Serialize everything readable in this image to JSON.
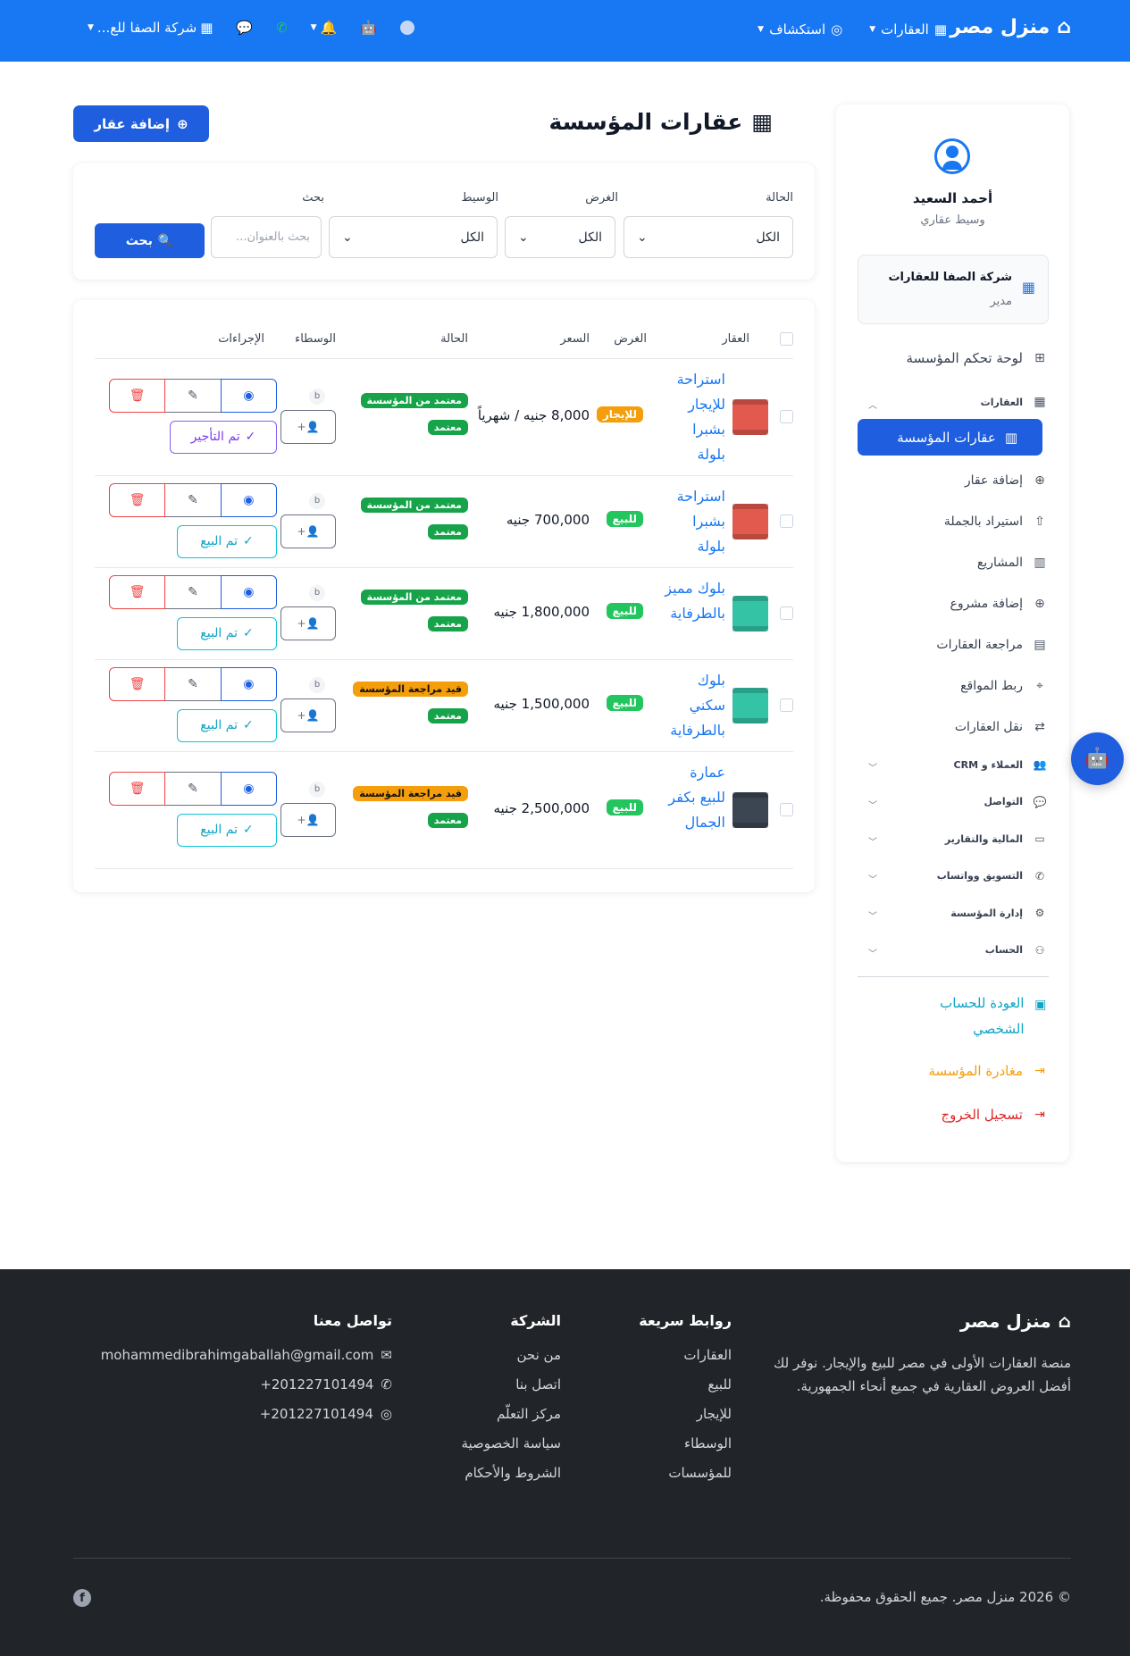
{
  "navbar": {
    "brand": "منزل مصر",
    "menu": [
      {
        "label": "العقارات",
        "icon": "building-icon"
      },
      {
        "label": "استكشاف",
        "icon": "compass-icon"
      }
    ],
    "org_switcher": "شركة الصفا للع..."
  },
  "page": {
    "title": "عقارات المؤسسة",
    "add_button": "إضافة عقار"
  },
  "filters": {
    "status_label": "الحالة",
    "status_value": "الكل",
    "purpose_label": "الغرض",
    "purpose_value": "الكل",
    "broker_label": "الوسيط",
    "broker_value": "الكل",
    "search_label": "بحث",
    "search_placeholder": "بحث بالعنوان...",
    "search_button": "بحث"
  },
  "table": {
    "headers": {
      "property": "العقار",
      "purpose": "الغرض",
      "price": "السعر",
      "status": "الحالة",
      "brokers": "الوسطاء",
      "actions": "الإجراءات"
    },
    "rows": [
      {
        "name": "استراحة للإيجار بشبرا بلولة",
        "purpose": "للإيجار",
        "purpose_color": "#f59e0b",
        "price": "8,000 جنيه / شهرياً",
        "status1": "معتمد من المؤسسة",
        "status2": "معتمد",
        "broker_initial": "b",
        "done_label": "تم التأجير",
        "thumb_color": "#e25a4d"
      },
      {
        "name": "استراحة بشبرا بلولة",
        "purpose": "للبيع",
        "purpose_color": "#22c55e",
        "price": "700,000 جنيه",
        "status1": "معتمد من المؤسسة",
        "status2": "معتمد",
        "broker_initial": "b",
        "done_label": "تم البيع",
        "thumb_color": "#e25a4d"
      },
      {
        "name": "بلوك مميز بالطرفاية",
        "purpose": "للبيع",
        "purpose_color": "#22c55e",
        "price": "1,800,000 جنيه",
        "status1": "معتمد من المؤسسة",
        "status2": "معتمد",
        "broker_initial": "b",
        "done_label": "تم البيع",
        "thumb_color": "#34c3a5"
      },
      {
        "name": "بلوك سكني بالطرفاية",
        "purpose": "للبيع",
        "purpose_color": "#22c55e",
        "price": "1,500,000 جنيه",
        "status1": "قيد مراجعة المؤسسة",
        "status2": "معتمد",
        "broker_initial": "b",
        "done_label": "تم البيع",
        "thumb_color": "#34c3a5"
      },
      {
        "name": "عمارة للبيع بكفر الجمال",
        "purpose": "للبيع",
        "purpose_color": "#22c55e",
        "price": "2,500,000 جنيه",
        "status1": "قيد مراجعة المؤسسة",
        "status2": "معتمد",
        "broker_initial": "b",
        "done_label": "تم البيع",
        "thumb_color": "#3b4652"
      }
    ]
  },
  "sidebar": {
    "user_name": "أحمد السعيد",
    "user_role": "وسيط عقاري",
    "org_name": "شركة الصفا للعقارات",
    "org_role": "مدير",
    "dashboard": "لوحة تحكم المؤسسة",
    "properties_group": "العقارات",
    "active_item": "عقارات المؤسسة",
    "items": [
      {
        "label": "إضافة عقار",
        "icon": "plus-circle-icon"
      },
      {
        "label": "استيراد بالجملة",
        "icon": "upload-icon"
      },
      {
        "label": "المشاريع",
        "icon": "chart-icon"
      },
      {
        "label": "إضافة مشروع",
        "icon": "plus-circle-icon"
      },
      {
        "label": "مراجعة العقارات",
        "icon": "clipboard-icon"
      },
      {
        "label": "ربط المواقع",
        "icon": "pin-icon"
      },
      {
        "label": "نقل العقارات",
        "icon": "transfer-icon"
      }
    ],
    "groups": [
      {
        "label": "العملاء و CRM",
        "icon": "users-icon"
      },
      {
        "label": "التواصل",
        "icon": "chat-icon"
      },
      {
        "label": "المالية والتقارير",
        "icon": "folder-icon"
      },
      {
        "label": "التسويق وواتساب",
        "icon": "whatsapp-icon"
      },
      {
        "label": "إدارة المؤسسة",
        "icon": "gear-icon"
      },
      {
        "label": "الحساب",
        "icon": "user-gear-icon"
      }
    ],
    "back_personal": "العودة للحساب الشخصي",
    "leave_org": "مغادرة المؤسسة",
    "logout": "تسجيل الخروج",
    "colors": {
      "back": "#0ea5c6",
      "leave": "#f59e0b",
      "logout": "#dc2626"
    }
  },
  "footer": {
    "brand": "منزل مصر",
    "description": "منصة العقارات الأولى في مصر للبيع والإيجار. نوفر لك أفضل العروض العقارية في جميع أنحاء الجمهورية.",
    "quick_links_title": "روابط سريعة",
    "quick_links": [
      "العقارات",
      "للبيع",
      "للإيجار",
      "الوسطاء",
      "للمؤسسات"
    ],
    "company_title": "الشركة",
    "company_links": [
      "من نحن",
      "اتصل بنا",
      "مركز التعلّم",
      "سياسة الخصوصية",
      "الشروط والأحكام"
    ],
    "contact_title": "تواصل معنا",
    "email": "mohammedibrahimgaballah@gmail.com",
    "phone": "201227101494+",
    "whatsapp": "201227101494+",
    "copyright": "© 2026 منزل مصر. جميع الحقوق محفوظة."
  }
}
